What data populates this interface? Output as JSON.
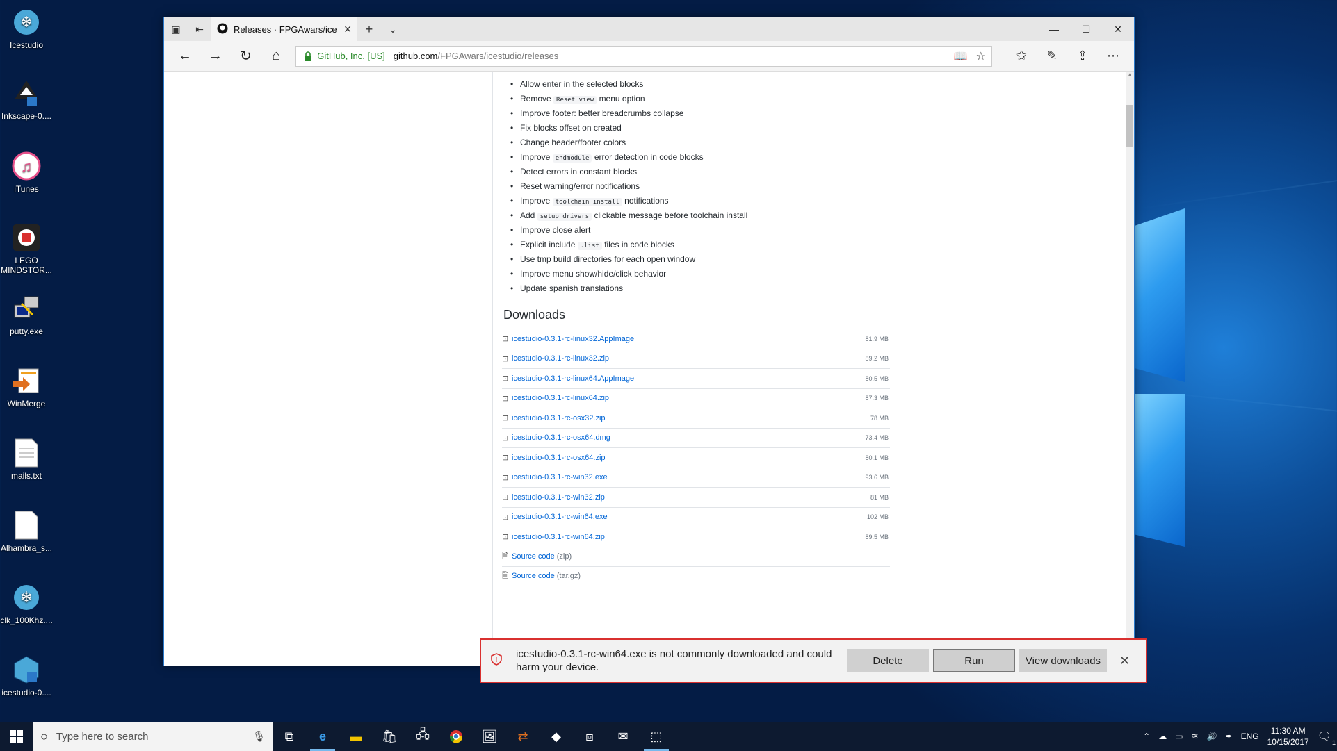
{
  "desktop": {
    "icons": [
      {
        "label": "Icestudio",
        "icon": "icestudio-icon"
      },
      {
        "label": "Inkscape-0....",
        "icon": "inkscape-icon"
      },
      {
        "label": "iTunes",
        "icon": "itunes-icon"
      },
      {
        "label": "LEGO MINDSTOR...",
        "icon": "lego-mindstorms-icon"
      },
      {
        "label": "putty.exe",
        "icon": "putty-icon"
      },
      {
        "label": "WinMerge",
        "icon": "winmerge-icon"
      },
      {
        "label": "mails.txt",
        "icon": "text-file-icon"
      },
      {
        "label": "Alhambra_s...",
        "icon": "file-icon"
      },
      {
        "label": "clk_100Khz....",
        "icon": "icestudio-file-icon"
      },
      {
        "label": "icestudio-0....",
        "icon": "icestudio-installer-icon"
      }
    ]
  },
  "browser": {
    "tab_title": "Releases · FPGAwars/ice",
    "address": {
      "company": "GitHub, Inc. [US]",
      "host": "github.com",
      "path": "/FPGAwars/icestudio/releases"
    }
  },
  "release_notes": [
    {
      "text": "Allow enter in the selected blocks"
    },
    {
      "pre": "Remove",
      "code": "Reset view",
      "post": "menu option"
    },
    {
      "text": "Improve footer: better breadcrumbs collapse"
    },
    {
      "text": "Fix blocks offset on created"
    },
    {
      "text": "Change header/footer colors"
    },
    {
      "pre": "Improve",
      "code": "endmodule",
      "post": "error detection in code blocks"
    },
    {
      "text": "Detect errors in constant blocks"
    },
    {
      "text": "Reset warning/error notifications"
    },
    {
      "pre": "Improve",
      "code": "toolchain install",
      "post": "notifications"
    },
    {
      "pre": "Add",
      "code": "setup drivers",
      "post": "clickable message before toolchain install"
    },
    {
      "text": "Improve close alert"
    },
    {
      "pre": "Explicit include",
      "code": ".list",
      "post": "files in code blocks"
    },
    {
      "text": "Use tmp build directories for each open window"
    },
    {
      "text": "Improve menu show/hide/click behavior"
    },
    {
      "text": "Update spanish translations"
    }
  ],
  "downloads": {
    "title": "Downloads",
    "assets": [
      {
        "name": "icestudio-0.3.1-rc-linux32.AppImage",
        "size": "81.9 MB"
      },
      {
        "name": "icestudio-0.3.1-rc-linux32.zip",
        "size": "89.2 MB"
      },
      {
        "name": "icestudio-0.3.1-rc-linux64.AppImage",
        "size": "80.5 MB"
      },
      {
        "name": "icestudio-0.3.1-rc-linux64.zip",
        "size": "87.3 MB"
      },
      {
        "name": "icestudio-0.3.1-rc-osx32.zip",
        "size": "78 MB"
      },
      {
        "name": "icestudio-0.3.1-rc-osx64.dmg",
        "size": "73.4 MB"
      },
      {
        "name": "icestudio-0.3.1-rc-osx64.zip",
        "size": "80.1 MB"
      },
      {
        "name": "icestudio-0.3.1-rc-win32.exe",
        "size": "93.6 MB"
      },
      {
        "name": "icestudio-0.3.1-rc-win32.zip",
        "size": "81 MB"
      },
      {
        "name": "icestudio-0.3.1-rc-win64.exe",
        "size": "102 MB"
      },
      {
        "name": "icestudio-0.3.1-rc-win64.zip",
        "size": "89.5 MB"
      }
    ],
    "source": [
      {
        "name": "Source code",
        "ext": "(zip)"
      },
      {
        "name": "Source code",
        "ext": "(tar.gz)"
      }
    ]
  },
  "download_warning": {
    "message": "icestudio-0.3.1-rc-win64.exe is not commonly downloaded and could harm your device.",
    "delete_label": "Delete",
    "run_label": "Run",
    "view_label": "View downloads"
  },
  "taskbar": {
    "search_placeholder": "Type here to search",
    "language": "ENG",
    "time": "11:30 AM",
    "date": "10/15/2017",
    "notification_count": "1"
  },
  "colors": {
    "link": "#0366d6",
    "warning_border": "#d9302f",
    "secure": "#2a8a2a",
    "taskbar": "#0d1a30"
  }
}
